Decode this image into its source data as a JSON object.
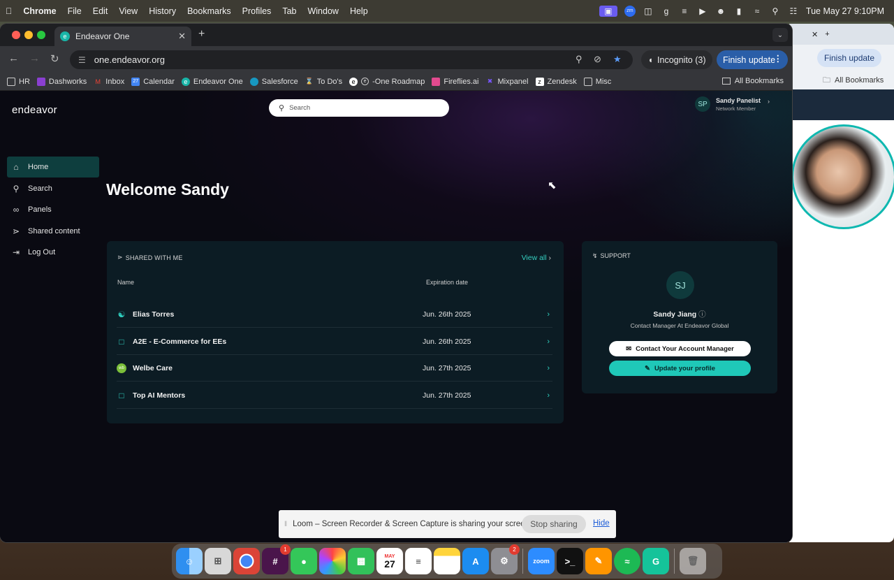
{
  "menubar": {
    "apple_icon": "apple-icon",
    "app_name": "Chrome",
    "items": [
      "File",
      "Edit",
      "View",
      "History",
      "Bookmarks",
      "Profiles",
      "Tab",
      "Window",
      "Help"
    ],
    "clock": "Tue May 27  9:10PM"
  },
  "browser": {
    "tab_title": "Endeavor One",
    "url": "one.endeavor.org",
    "incognito_label": "Incognito (3)",
    "finish_update_label": "Finish update",
    "bookmarks": [
      "HR",
      "Dashworks",
      "Inbox",
      "Calendar",
      "Endeavor One",
      "Salesforce",
      "To Do's",
      "-One Roadmap",
      "Fireflies.ai",
      "Mixpanel",
      "Zendesk",
      "Misc"
    ],
    "all_bookmarks_label": "All Bookmarks"
  },
  "back_window": {
    "finish_update_label": "Finish update",
    "all_bookmarks_label": "All Bookmarks"
  },
  "app": {
    "logo": "endeavor",
    "search_placeholder": "Search",
    "user": {
      "initials": "SP",
      "name": "Sandy Panelist",
      "role": "Network Member"
    },
    "sidebar": [
      {
        "label": "Home",
        "icon": "home-icon"
      },
      {
        "label": "Search",
        "icon": "search-icon"
      },
      {
        "label": "Panels",
        "icon": "link-icon"
      },
      {
        "label": "Shared content",
        "icon": "share-icon"
      },
      {
        "label": "Log Out",
        "icon": "logout-icon"
      }
    ],
    "welcome": "Welcome Sandy",
    "shared": {
      "header": "SHARED WITH ME",
      "view_all": "View all",
      "col_name": "Name",
      "col_date": "Expiration date",
      "rows": [
        {
          "name": "Elias Torres",
          "date": "Jun. 26th 2025",
          "icon": "person-icon"
        },
        {
          "name": "A2E - E-Commerce for EEs",
          "date": "Jun. 26th 2025",
          "icon": "bookmark-icon"
        },
        {
          "name": "Welbe Care",
          "date": "Jun. 27th 2025",
          "icon": "company-logo-icon"
        },
        {
          "name": "Top AI Mentors",
          "date": "Jun. 27th 2025",
          "icon": "bookmark-icon"
        }
      ]
    },
    "support": {
      "header": "SUPPORT",
      "initials": "SJ",
      "name": "Sandy Jiang",
      "role": "Contact Manager At Endeavor Global",
      "contact_button": "Contact Your Account Manager",
      "update_button": "Update your profile"
    }
  },
  "loom": {
    "message": "Loom – Screen Recorder & Screen Capture is sharing your screen.",
    "stop_label": "Stop sharing",
    "hide_label": "Hide"
  },
  "dock": {
    "badges": {
      "slack": "1",
      "system_settings": "2"
    },
    "calendar_month": "MAY",
    "calendar_day": "27",
    "zoom_label": "zoom"
  },
  "colors": {
    "accent": "#1fc8b8",
    "panel": "#0c1c24",
    "active_nav": "#0e3e3e",
    "finish_update": "#2a5ea8"
  }
}
